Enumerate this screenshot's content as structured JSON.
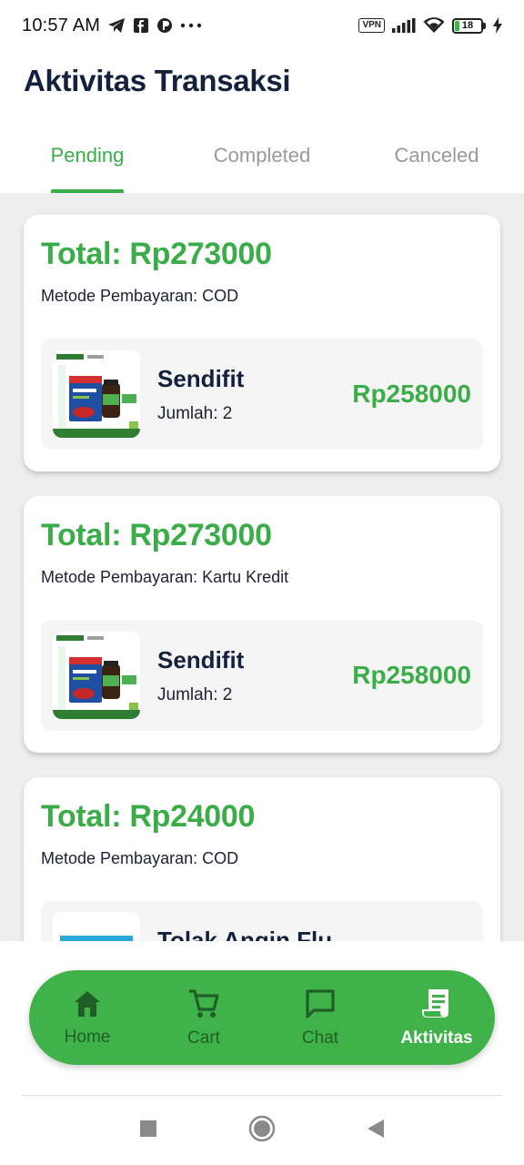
{
  "status_bar": {
    "time": "10:57 AM",
    "vpn": "VPN",
    "battery": "18",
    "battery_level": 0.18,
    "icons": [
      "telegram-icon",
      "facebook-icon",
      "app-icon",
      "more-dots-icon",
      "signal-icon",
      "wifi-icon",
      "battery-icon",
      "charging-icon"
    ]
  },
  "header": {
    "title": "Aktivitas Transaksi"
  },
  "tabs": [
    {
      "label": "Pending",
      "active": true
    },
    {
      "label": "Completed",
      "active": false
    },
    {
      "label": "Canceled",
      "active": false
    }
  ],
  "transactions": [
    {
      "total": "Total: Rp273000",
      "method": "Metode Pembayaran: COD",
      "items": [
        {
          "name": "Sendifit",
          "qty": "Jumlah: 2",
          "price": "Rp258000"
        }
      ]
    },
    {
      "total": "Total: Rp273000",
      "method": "Metode Pembayaran: Kartu Kredit",
      "items": [
        {
          "name": "Sendifit",
          "qty": "Jumlah: 2",
          "price": "Rp258000"
        }
      ]
    },
    {
      "total": "Total: Rp24000",
      "method": "Metode Pembayaran: COD",
      "items": [
        {
          "name": "Tolak Angin Flu",
          "qty": "",
          "price": ""
        }
      ]
    }
  ],
  "bottom_nav": [
    {
      "label": "Home",
      "icon": "home-icon",
      "active": false
    },
    {
      "label": "Cart",
      "icon": "cart-icon",
      "active": false
    },
    {
      "label": "Chat",
      "icon": "chat-icon",
      "active": false
    },
    {
      "label": "Aktivitas",
      "icon": "receipt-icon",
      "active": true
    }
  ],
  "colors": {
    "accent": "#3aad49",
    "nav_bg": "#3fb24a",
    "title": "#14213d",
    "content_bg": "#eeeeee"
  }
}
